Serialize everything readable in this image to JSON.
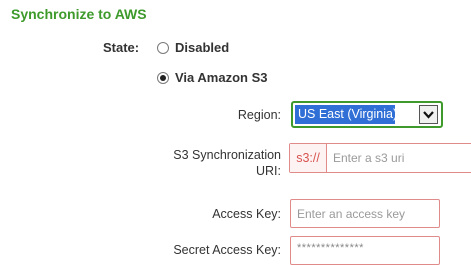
{
  "section": {
    "title": "Synchronize to AWS"
  },
  "state": {
    "label": "State:",
    "options": [
      {
        "label": "Disabled",
        "checked": false
      },
      {
        "label": "Via Amazon S3",
        "checked": true
      }
    ]
  },
  "region": {
    "label": "Region:",
    "selected": "US East (Virginia)"
  },
  "s3_uri": {
    "label_line1": "S3 Synchronization",
    "label_line2": "URI:",
    "prefix": "s3://",
    "placeholder": "Enter a s3 uri",
    "value": ""
  },
  "access_key": {
    "label": "Access Key:",
    "placeholder": "Enter an access key",
    "value": ""
  },
  "secret_key": {
    "label": "Secret Access Key:",
    "masked_value": "**************"
  },
  "colors": {
    "title": "#3d9a2b",
    "select_highlight": "#2f6fd6",
    "error_border": "#e08a8a",
    "prefix_text": "#d9534f"
  }
}
